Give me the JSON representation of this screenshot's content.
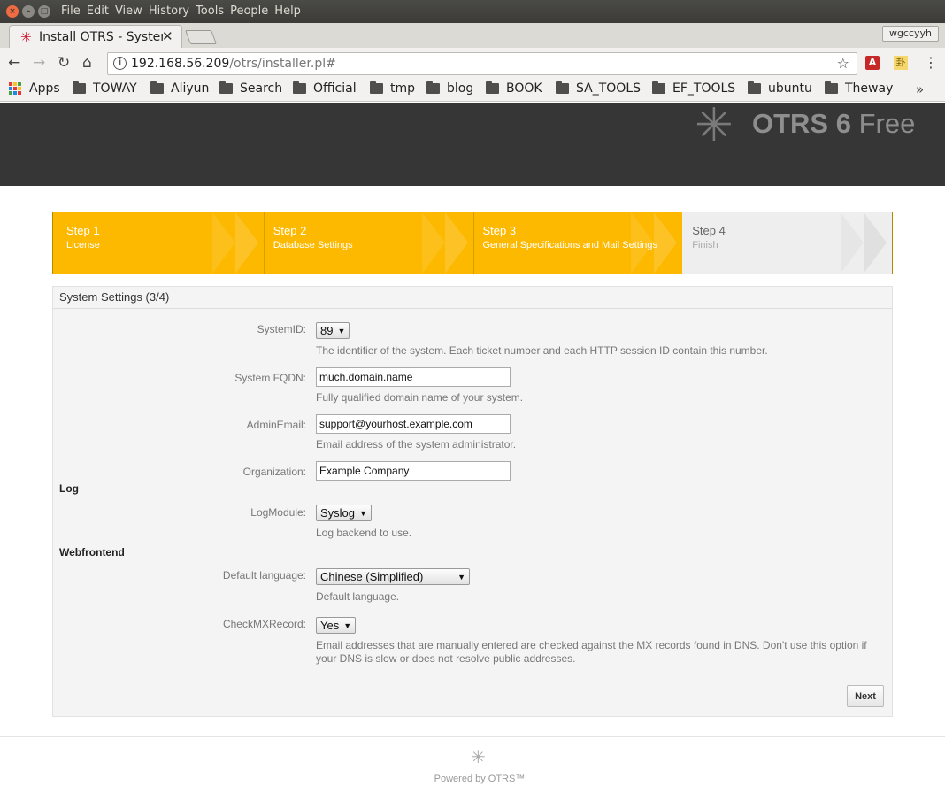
{
  "window": {
    "menu": [
      "File",
      "Edit",
      "View",
      "History",
      "Tools",
      "People",
      "Help"
    ]
  },
  "browser": {
    "tab_title": "Install OTRS - Syster",
    "profile": "wgccyyh",
    "url_host": "192.168.56.209",
    "url_path": "/otrs/installer.pl#",
    "bookmarks": [
      "Apps",
      "TOWAY",
      "Aliyun",
      "Search",
      "Official",
      "tmp",
      "blog",
      "BOOK",
      "SA_TOOLS",
      "EF_TOOLS",
      "ubuntu",
      "Theway"
    ],
    "bookmarks_more": "»"
  },
  "header": {
    "logo_prefix": "OTRS 6",
    "logo_suffix": "Free"
  },
  "steps": [
    {
      "num": "Step 1",
      "name": "License",
      "state": "done"
    },
    {
      "num": "Step 2",
      "name": "Database Settings",
      "state": "done"
    },
    {
      "num": "Step 3",
      "name": "General Specifications and Mail Settings",
      "state": "active"
    },
    {
      "num": "Step 4",
      "name": "Finish",
      "state": "todo"
    }
  ],
  "panel": {
    "title": "System Settings (3/4)",
    "system_id": {
      "label": "SystemID:",
      "value": "89",
      "desc": "The identifier of the system. Each ticket number and each HTTP session ID contain this number."
    },
    "fqdn": {
      "label": "System FQDN:",
      "value": "much.domain.name",
      "desc": "Fully qualified domain name of your system."
    },
    "admin_email": {
      "label": "AdminEmail:",
      "value": "support@yourhost.example.com",
      "desc": "Email address of the system administrator."
    },
    "organization": {
      "label": "Organization:",
      "value": "Example Company"
    },
    "log_heading": "Log",
    "log_module": {
      "label": "LogModule:",
      "value": "Syslog",
      "desc": "Log backend to use."
    },
    "web_heading": "Webfrontend",
    "language": {
      "label": "Default language:",
      "value": "Chinese (Simplified)",
      "desc": "Default language."
    },
    "check_mx": {
      "label": "CheckMXRecord:",
      "value": "Yes",
      "desc": "Email addresses that are manually entered are checked against the MX records found in DNS. Don't use this option if your DNS is slow or does not resolve public addresses."
    },
    "next_label": "Next"
  },
  "footer": {
    "powered_by": "Powered by OTRS™"
  },
  "colors": {
    "step_active": "#fdb900",
    "header_bg": "#363636"
  }
}
